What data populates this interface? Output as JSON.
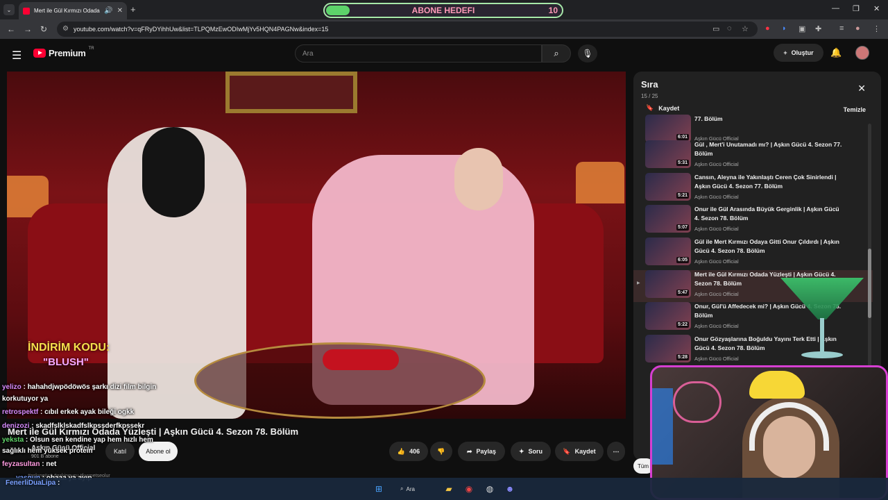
{
  "browser": {
    "tab_title": "Mert ile Gül Kırmızı Odada",
    "url": "youtube.com/watch?v=qFRyDYihhUw&list=TLPQMzEwODIwMjYv5HQN4PAGNw&index=15"
  },
  "goal_widget": {
    "label": "ABONE HEDEFI",
    "count": "10",
    "progress": 0.1
  },
  "youtube": {
    "logo_text": "Premium",
    "logo_region": "TR",
    "search_placeholder": "Ara",
    "create_label": "Oluştur"
  },
  "video": {
    "promo_line1": "İNDİRİM KODU:",
    "promo_line2": "\"BLUSH\"",
    "title": "Mert ile Gül Kırmızı Odada Yüzleşti | Aşkın Gücü 4. Sezon 78. Bölüm",
    "channel": "Aşkın Gücü Official",
    "subscribers": "901 B abone",
    "join_label": "Katıl",
    "subscribe_label": "Abone ol",
    "like_count": "406",
    "share_label": "Paylaş",
    "ask_label": "Soru",
    "save_label": "Kaydet",
    "description_snippet": "#aşkıngücü #askingucu #kısmetseolur"
  },
  "queue": {
    "title": "Sıra",
    "position": "15 / 25",
    "save_label": "Kaydet",
    "clear_label": "Temizle",
    "items": [
      {
        "title": "77. Bölüm",
        "channel": "Aşkın Gücü Official",
        "duration": "6:01",
        "active": false
      },
      {
        "title": "Gül , Mert'i Unutamadı mı? | Aşkın Gücü 4. Sezon 77. Bölüm",
        "channel": "Aşkın Gücü Official",
        "duration": "5:31",
        "active": false
      },
      {
        "title": "Cansın, Aleyna ile Yakınlaştı Ceren Çok Sinirlendi | Aşkın Gücü 4. Sezon 77. Bölüm",
        "channel": "Aşkın Gücü Official",
        "duration": "5:21",
        "active": false
      },
      {
        "title": "Onur ile Gül Arasında Büyük Gerginlik | Aşkın Gücü 4. Sezon 78. Bölüm",
        "channel": "Aşkın Gücü Official",
        "duration": "5:07",
        "active": false
      },
      {
        "title": "Gül ile Mert Kırmızı Odaya Gitti Onur Çıldırdı | Aşkın Gücü 4. Sezon 78. Bölüm",
        "channel": "Aşkın Gücü Official",
        "duration": "6:05",
        "active": false
      },
      {
        "title": "Mert ile Gül Kırmızı Odada Yüzleşti | Aşkın Gücü 4. Sezon 78. Bölüm",
        "channel": "Aşkın Gücü Official",
        "duration": "5:47",
        "active": true
      },
      {
        "title": "Onur, Gül'ü Affedecek mi? | Aşkın Gücü 4. Sezon 78. Bölüm",
        "channel": "Aşkın Gücü Official",
        "duration": "5:22",
        "active": false
      },
      {
        "title": "Onur Gözyaşlarına Boğuldu Yayını Terk Etti | Aşkın Gücü 4. Sezon 78. Bölüm",
        "channel": "Aşkın Gücü Official",
        "duration": "5:28",
        "active": false
      }
    ]
  },
  "partial_button": "Tüm",
  "chat": [
    {
      "user": "yelizo",
      "color": "#d98cff",
      "text": "hahahdjwpödöwös şarkı dizi film bilgin"
    },
    {
      "user": "",
      "color": "#ffffff",
      "text": "korkutuyor ya"
    },
    {
      "user": "retrospektf",
      "color": "#d98cff",
      "text": "cıbıl erkek ayak bileği ogkk"
    },
    {
      "user": "denizozi",
      "color": "#d98cff",
      "text": "skadfslklskadfslkpssderfkpssekr"
    },
    {
      "user": "yeksta",
      "color": "#62d86b",
      "text": "Olsun sen kendine yap hem hızlı hem"
    },
    {
      "user": "",
      "color": "#ffffff",
      "text": "sağlıklı hem yüksek protein"
    },
    {
      "user": "feyzasultan",
      "color": "#ff9be0",
      "text": "net"
    },
    {
      "user": "yasgun",
      "color": "#7aa0ff",
      "text": "ohaaa ya ayıp"
    },
    {
      "user": "FenerliDuaLipa",
      "color": "#7aa0ff",
      "text": ""
    }
  ],
  "taskbar": {
    "search_label": "Ara"
  }
}
